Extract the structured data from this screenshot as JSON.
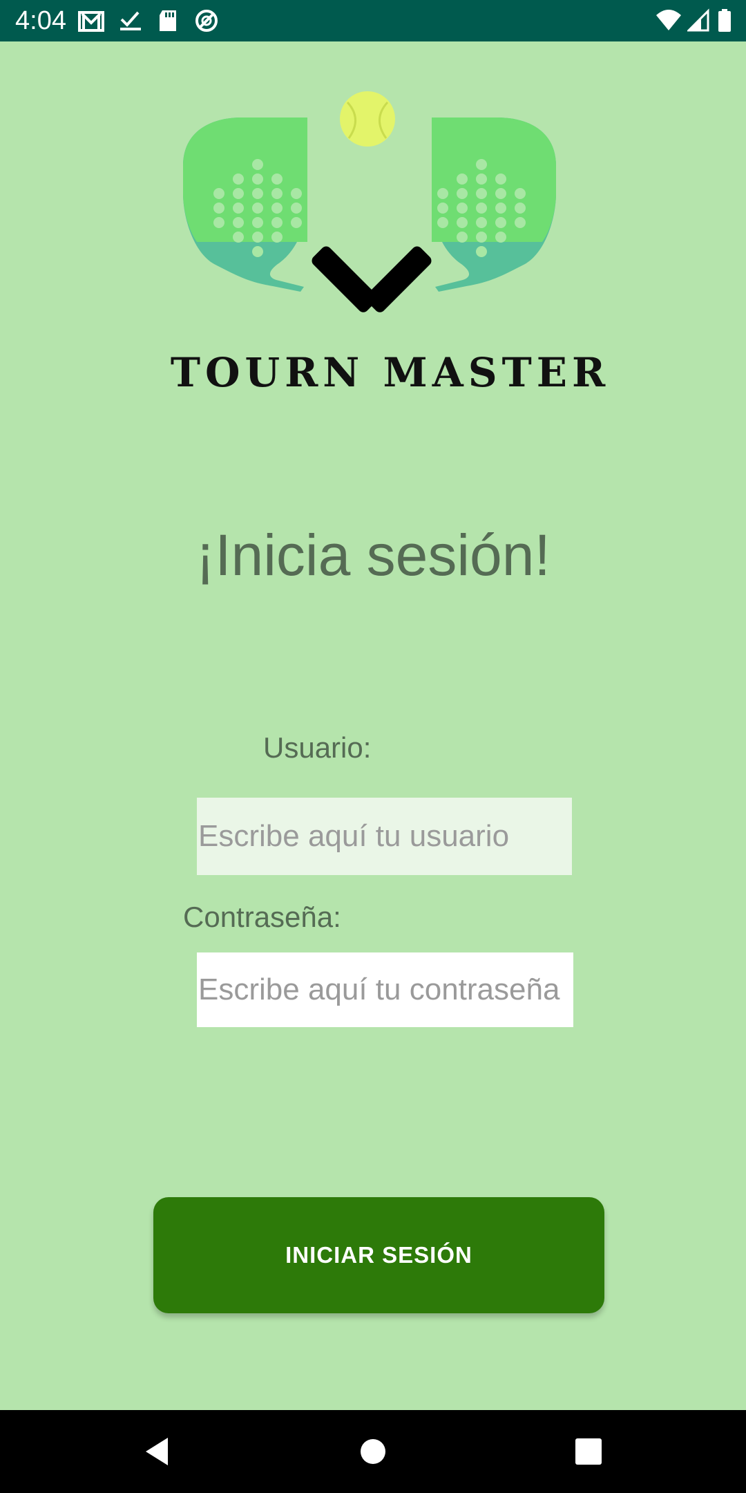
{
  "status_bar": {
    "time": "4:04",
    "left_icons": [
      "gmail-icon",
      "check-icon",
      "sd-card-icon",
      "sync-icon"
    ],
    "right_icons": [
      "wifi-icon",
      "signal-icon",
      "battery-icon"
    ]
  },
  "logo": {
    "brand_name": "TOURN MASTER",
    "icon": "padel-rackets-ball-logo"
  },
  "heading": "¡Inicia sesión!",
  "form": {
    "username_label": "Usuario:",
    "username_placeholder": "Escribe aquí tu usuario",
    "username_value": "",
    "password_label": "Contraseña:",
    "password_placeholder": "Escribe aquí tu contraseña",
    "password_value": ""
  },
  "login_button": {
    "label": "INICIAR SESIÓN"
  },
  "nav_bar": {
    "buttons": [
      "back-icon",
      "home-icon",
      "recents-icon"
    ]
  },
  "colors": {
    "background": "#b5e4ac",
    "status_bar": "#005a4e",
    "button": "#2d7a09",
    "text": "#556b54"
  }
}
